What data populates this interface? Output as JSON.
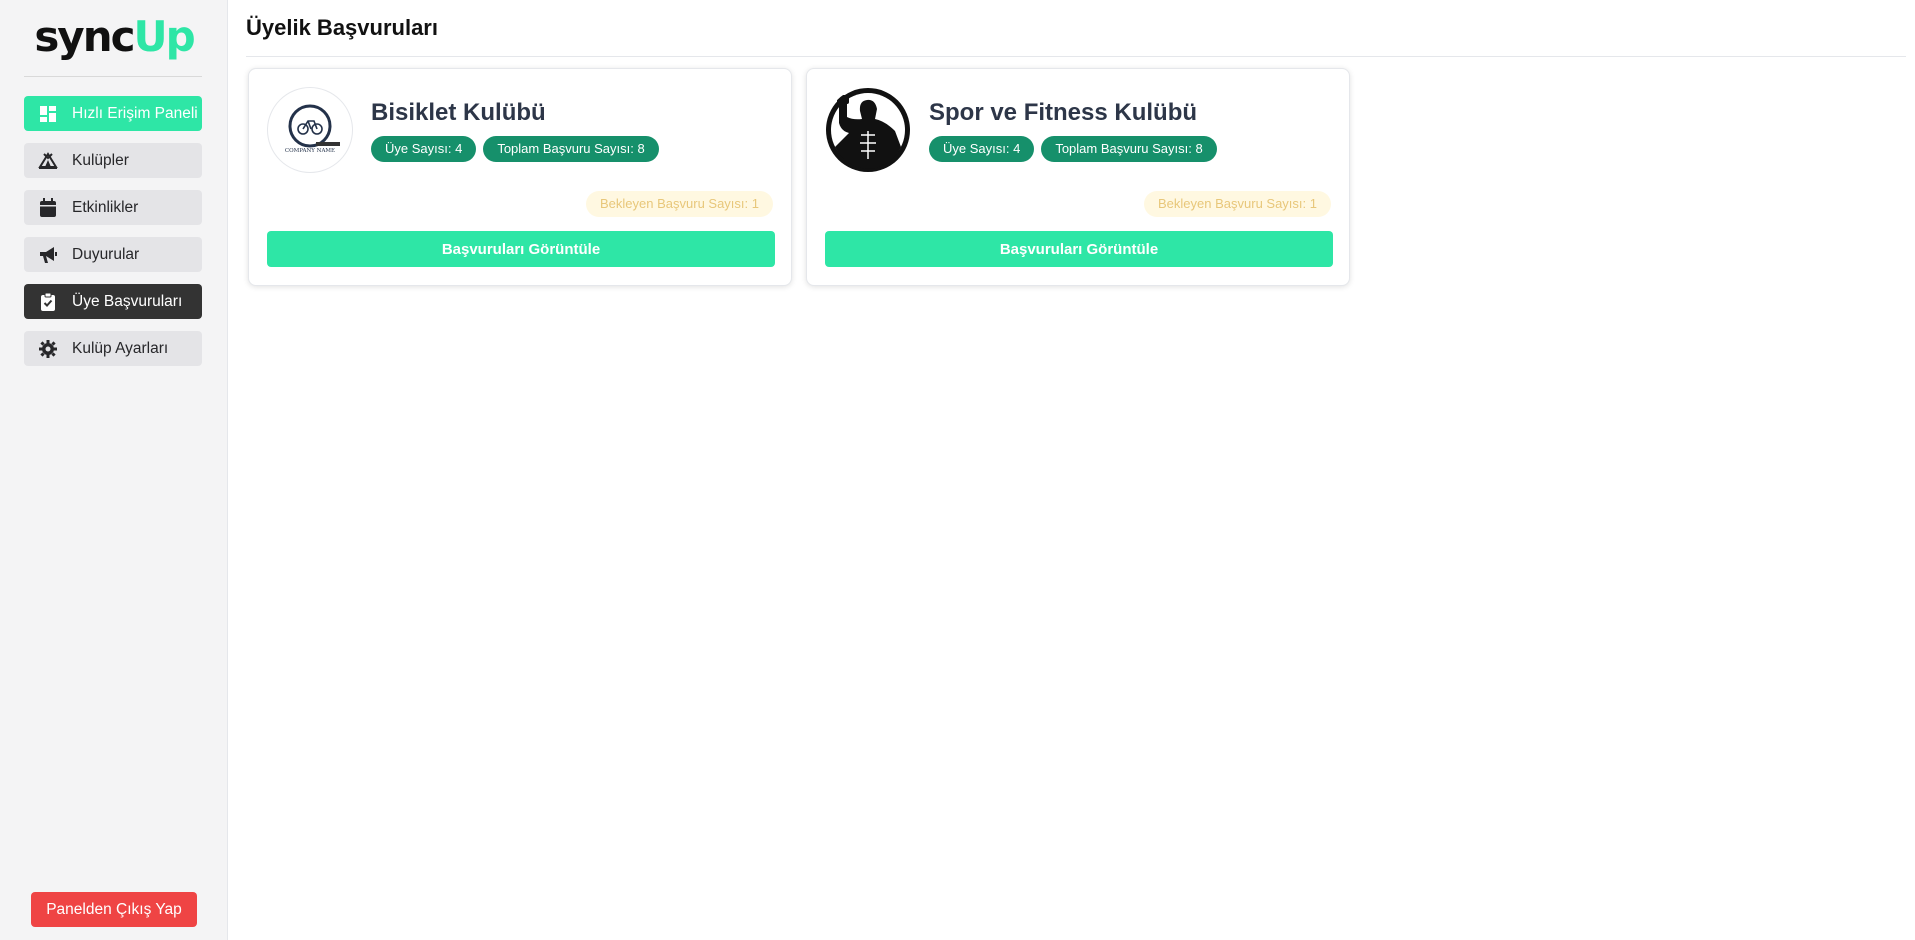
{
  "brand": {
    "part1": "sync",
    "part2": "Up"
  },
  "sidebar": {
    "items": [
      {
        "label": "Hızlı Erişim Paneli",
        "icon": "dashboard-icon"
      },
      {
        "label": "Kulüpler",
        "icon": "campground-icon"
      },
      {
        "label": "Etkinlikler",
        "icon": "calendar-icon"
      },
      {
        "label": "Duyurular",
        "icon": "megaphone-icon"
      },
      {
        "label": "Üye Başvuruları",
        "icon": "clipboard-check-icon"
      },
      {
        "label": "Kulüp Ayarları",
        "icon": "gear-icon"
      }
    ],
    "logout_label": "Panelden Çıkış Yap"
  },
  "main": {
    "title": "Üyelik Başvuruları",
    "clubs": [
      {
        "name": "Bisiklet Kulübü",
        "members": "Üye Sayısı: 4",
        "total_applications": "Toplam Başvuru Sayısı: 8",
        "pending": "Bekleyen Başvuru Sayısı: 1",
        "button_label": "Başvuruları Görüntüle",
        "logo_text": "COMPANY NAME"
      },
      {
        "name": "Spor ve Fitness Kulübü",
        "members": "Üye Sayısı: 4",
        "total_applications": "Toplam Başvuru Sayısı: 8",
        "pending": "Bekleyen Başvuru Sayısı: 1",
        "button_label": "Başvuruları Görüntüle"
      }
    ]
  },
  "colors": {
    "accent": "#2ee6a6",
    "active_nav": "#333333",
    "badge": "#16906b",
    "logout": "#ef4444",
    "pending_bg": "#fff8e1",
    "pending_text": "#e8c77a"
  }
}
